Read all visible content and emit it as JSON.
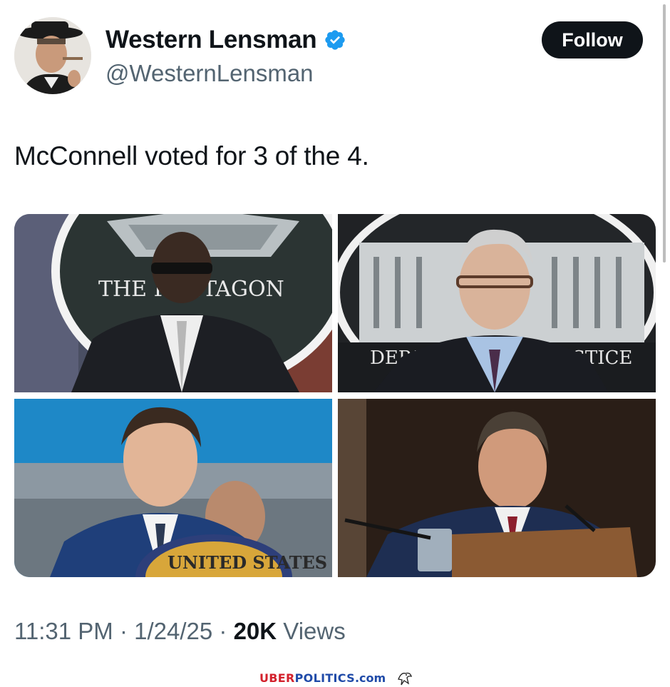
{
  "author": {
    "display_name": "Western Lensman",
    "handle": "@WesternLensman",
    "verified_icon": "verified-badge-icon",
    "avatar_icon": "avatar-photo"
  },
  "follow_button": {
    "label": "Follow"
  },
  "tweet": {
    "text": "McConnell voted for 3 of the 4.",
    "photos": [
      {
        "backdrop_text": "THE PENTAGON"
      },
      {
        "backdrop_text": "DEPARTMENT OF JUSTICE"
      },
      {
        "backdrop_text": "UNITED STATES"
      },
      {
        "backdrop_text": ""
      }
    ]
  },
  "meta": {
    "time": "11:31 PM",
    "separator": " · ",
    "date": "1/24/25",
    "views_count": "20K",
    "views_label": " Views"
  },
  "watermark": {
    "part1": "UBER",
    "part2": "POLITICS",
    "part3": ".com",
    "icon": "eagle-icon"
  },
  "colors": {
    "follow_bg": "#0f1419",
    "secondary_text": "#536471",
    "verified_blue": "#1d9bf0",
    "watermark_red": "#d3212c",
    "watermark_blue": "#1f4aa8"
  }
}
